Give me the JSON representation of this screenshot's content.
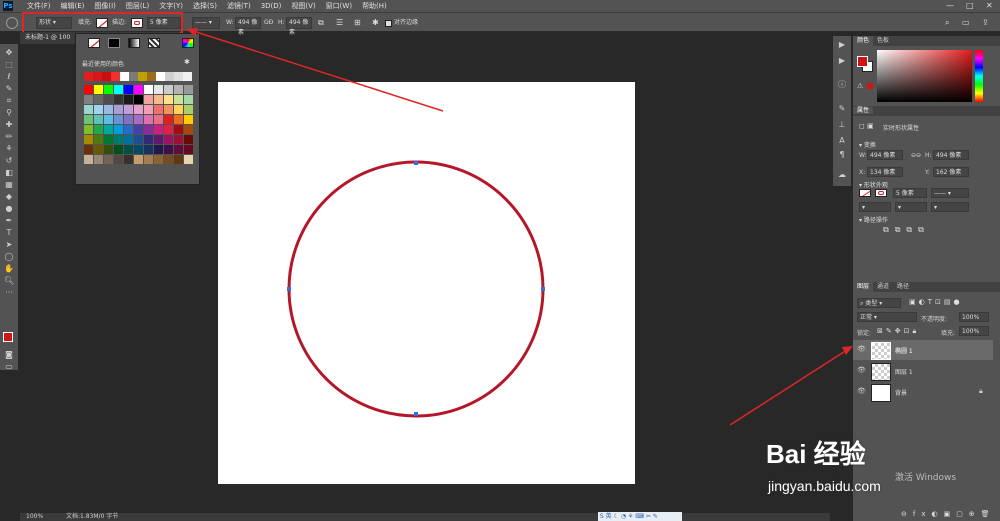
{
  "menu": [
    "文件(F)",
    "编辑(E)",
    "图像(I)",
    "图层(L)",
    "文字(Y)",
    "选择(S)",
    "滤镜(T)",
    "3D(D)",
    "视图(V)",
    "窗口(W)",
    "帮助(H)"
  ],
  "ps_logo": "Ps",
  "options": {
    "shape_mode": "形状",
    "fill_label": "填充:",
    "stroke_label": "描边:",
    "stroke_width": "5 像素",
    "w_label": "W:",
    "w_value": "494 像素",
    "link": "GÐ",
    "h_label": "H:",
    "h_value": "494 像素",
    "align_edges": "对齐边缘"
  },
  "doc_tab": "未标题-1 @ 100",
  "popup": {
    "recent_label": "最近使用的颜色"
  },
  "panels": {
    "color_tabs": [
      "颜色",
      "色板"
    ],
    "props_tab": "属性",
    "props_title": "实时形状属性",
    "section_transform": "变换",
    "w_label": "W:",
    "w_value": "494 像素",
    "h_label": "H:",
    "h_value": "494 像素",
    "x_label": "X:",
    "x_value": "134 像素",
    "y_label": "Y:",
    "y_value": "162 像素",
    "section_appearance": "形状外观",
    "stroke_width": "5 像素",
    "section_path": "路径操作",
    "layers_tabs": [
      "图层",
      "通道",
      "路径"
    ],
    "kind_filter": "类型",
    "blend_mode": "正常",
    "opacity_label": "不透明度:",
    "opacity_value": "100%",
    "lock_label": "锁定:",
    "fill_label": "填充:",
    "fill_value": "100%",
    "layers": [
      "椭圆 1",
      "图层 1",
      "背景"
    ]
  },
  "status": {
    "zoom": "100%",
    "doc": "文档:1.83M/0 字节"
  },
  "watermark": {
    "brand": "Bai 经验",
    "url": "jingyan.baidu.com",
    "activate": "激活 Windows"
  },
  "colors": {
    "stroke": "#b5172a",
    "annotation": "#e02525"
  }
}
